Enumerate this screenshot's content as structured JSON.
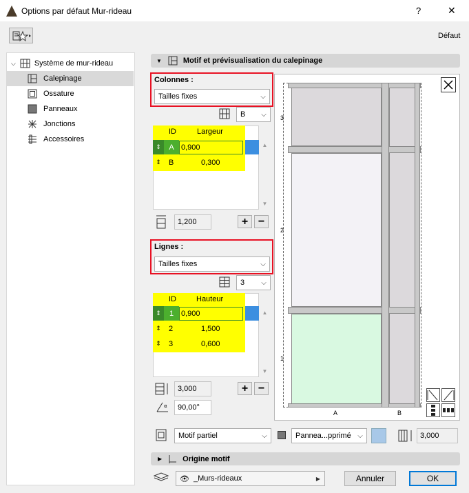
{
  "window": {
    "title": "Options par défaut Mur-rideau",
    "help": "?",
    "close": "✕"
  },
  "topbar": {
    "profile": "Défaut"
  },
  "sidebar": {
    "root": "Système de mur-rideau",
    "items": [
      {
        "label": "Calepinage",
        "icon": "grid-pattern-icon"
      },
      {
        "label": "Ossature",
        "icon": "frame-icon"
      },
      {
        "label": "Panneaux",
        "icon": "panel-icon"
      },
      {
        "label": "Jonctions",
        "icon": "junction-icon"
      },
      {
        "label": "Accessoires",
        "icon": "accessories-icon"
      }
    ]
  },
  "section": {
    "title": "Motif et prévisualisation du calepinage"
  },
  "columns": {
    "label": "Colonnes :",
    "mode": "Tailles fixes",
    "count_value": "B",
    "headers": {
      "id": "ID",
      "value": "Largeur"
    },
    "rows": [
      {
        "id": "A",
        "value": "0,900"
      },
      {
        "id": "B",
        "value": "0,300"
      }
    ],
    "total": "1,200"
  },
  "rows_section": {
    "label": "Lignes :",
    "mode": "Tailles fixes",
    "count_value": "3",
    "headers": {
      "id": "ID",
      "value": "Hauteur"
    },
    "rows": [
      {
        "id": "1",
        "value": "0,900"
      },
      {
        "id": "2",
        "value": "1,500"
      },
      {
        "id": "3",
        "value": "0,600"
      }
    ],
    "total": "3,000",
    "angle": "90,00°"
  },
  "preview": {
    "row_labels": [
      "3",
      "2",
      "1"
    ],
    "col_labels": [
      "A",
      "B"
    ]
  },
  "bottom": {
    "pattern_mode": "Motif partiel",
    "panel": "Pannea...pprimé",
    "height": "3,000",
    "origin": "Origine motif"
  },
  "footer": {
    "layer": "_Murs-rideaux",
    "cancel": "Annuler",
    "ok": "OK"
  }
}
